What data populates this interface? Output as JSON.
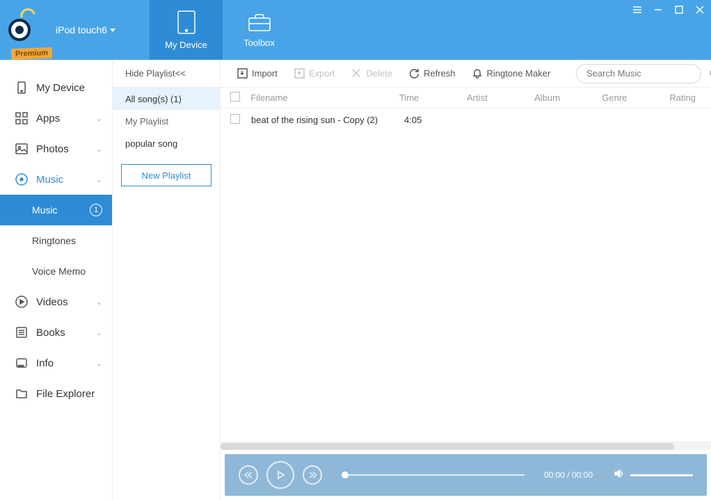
{
  "device_name": "iPod touch6",
  "premium_label": "Premium",
  "tabs": {
    "my_device": "My Device",
    "toolbox": "Toolbox"
  },
  "sidebar": {
    "my_device": "My Device",
    "apps": "Apps",
    "photos": "Photos",
    "music": "Music",
    "music_sub": {
      "music": "Music",
      "badge": "1",
      "ringtones": "Ringtones",
      "voice_memo": "Voice Memo"
    },
    "videos": "Videos",
    "books": "Books",
    "info": "Info",
    "file_explorer": "File Explorer"
  },
  "playlist_panel": {
    "hide": "Hide Playlist<<",
    "items": [
      {
        "label": "All song(s)  (1)"
      },
      {
        "label": "My Playlist"
      },
      {
        "label": "popular song"
      }
    ],
    "new_playlist": "New Playlist"
  },
  "toolbar": {
    "import": "Import",
    "export": "Export",
    "delete": "Delete",
    "refresh": "Refresh",
    "ringtone_maker": "Ringtone Maker",
    "search_placeholder": "Search Music"
  },
  "columns": {
    "filename": "Filename",
    "time": "Time",
    "artist": "Artist",
    "album": "Album",
    "genre": "Genre",
    "rating": "Rating"
  },
  "rows": [
    {
      "filename": "beat of the rising sun - Copy (2)",
      "time": "4:05"
    }
  ],
  "player": {
    "time_display": "00:00 / 00:00"
  }
}
